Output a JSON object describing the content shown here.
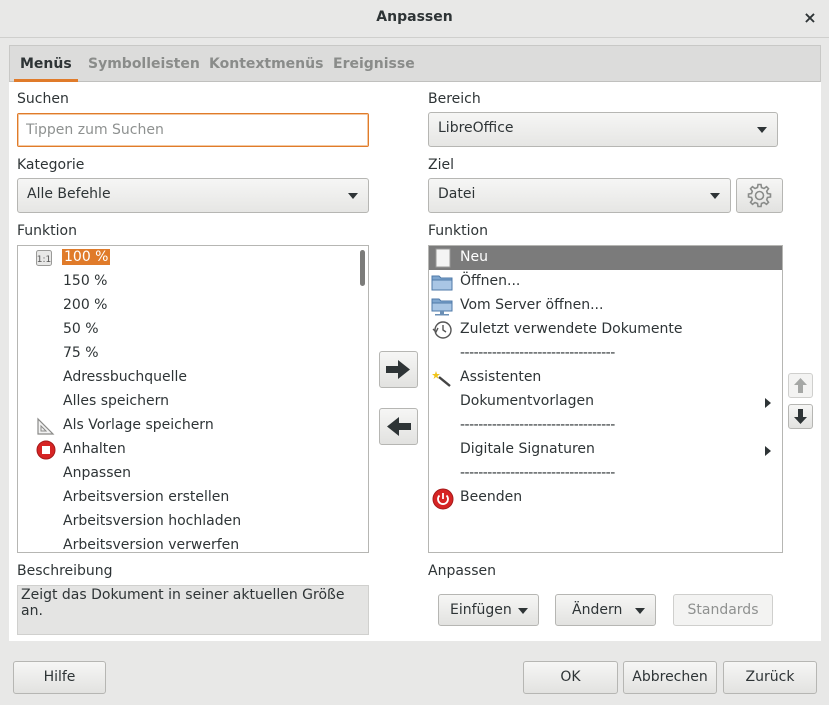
{
  "window": {
    "title": "Anpassen",
    "close_glyph": "×"
  },
  "tabs": [
    {
      "label": "Menüs"
    },
    {
      "label": "Symbolleisten"
    },
    {
      "label": "Kontextmenüs"
    },
    {
      "label": "Ereignisse"
    }
  ],
  "left": {
    "search_label": "Suchen",
    "search_placeholder": "Tippen zum Suchen",
    "category_label": "Kategorie",
    "category_value": "Alle Befehle",
    "function_label": "Funktion",
    "functions": [
      {
        "label": "100 %",
        "icon": "zoom-100-icon"
      },
      {
        "label": "150 %",
        "icon": ""
      },
      {
        "label": "200 %",
        "icon": ""
      },
      {
        "label": "50 %",
        "icon": ""
      },
      {
        "label": "75 %",
        "icon": ""
      },
      {
        "label": "Adressbuchquelle",
        "icon": ""
      },
      {
        "label": "Alles speichern",
        "icon": ""
      },
      {
        "label": "Als Vorlage speichern",
        "icon": "template-icon"
      },
      {
        "label": "Anhalten",
        "icon": "stop-icon"
      },
      {
        "label": "Anpassen",
        "icon": ""
      },
      {
        "label": "Arbeitsversion erstellen",
        "icon": ""
      },
      {
        "label": "Arbeitsversion hochladen",
        "icon": ""
      },
      {
        "label": "Arbeitsversion verwerfen",
        "icon": ""
      }
    ],
    "description_label": "Beschreibung",
    "description_text": "Zeigt das Dokument in seiner aktuellen Größe an."
  },
  "right": {
    "scope_label": "Bereich",
    "scope_value": "LibreOffice",
    "target_label": "Ziel",
    "target_value": "Datei",
    "function_label": "Funktion",
    "entries": [
      {
        "label": "Neu",
        "icon": "new-document-icon",
        "submenu": false,
        "selected": true
      },
      {
        "label": "Öffnen...",
        "icon": "folder-icon",
        "submenu": false,
        "selected": false
      },
      {
        "label": "Vom Server öffnen...",
        "icon": "server-folder-icon",
        "submenu": false,
        "selected": false
      },
      {
        "label": "Zuletzt verwendete Dokumente",
        "icon": "recent-documents-icon",
        "submenu": false,
        "selected": false
      },
      {
        "label": "----------------------------------",
        "icon": "",
        "submenu": false,
        "selected": false
      },
      {
        "label": "Assistenten",
        "icon": "wizard-icon",
        "submenu": false,
        "selected": false
      },
      {
        "label": "Dokumentvorlagen",
        "icon": "",
        "submenu": true,
        "selected": false
      },
      {
        "label": "----------------------------------",
        "icon": "",
        "submenu": false,
        "selected": false
      },
      {
        "label": "Digitale Signaturen",
        "icon": "",
        "submenu": true,
        "selected": false
      },
      {
        "label": "----------------------------------",
        "icon": "",
        "submenu": false,
        "selected": false
      },
      {
        "label": "Beenden",
        "icon": "exit-icon",
        "submenu": false,
        "selected": false
      }
    ],
    "customize_label": "Anpassen",
    "insert_button": "Einfügen",
    "modify_button": "Ändern",
    "defaults_button": "Standards"
  },
  "footer": {
    "help_button": "Hilfe",
    "ok_button": "OK",
    "cancel_button": "Abbrechen",
    "reset_button": "Zurück"
  },
  "colors": {
    "accent": "#e07b2a",
    "selection": "#7b7b7b",
    "stop_red": "#d62424"
  }
}
